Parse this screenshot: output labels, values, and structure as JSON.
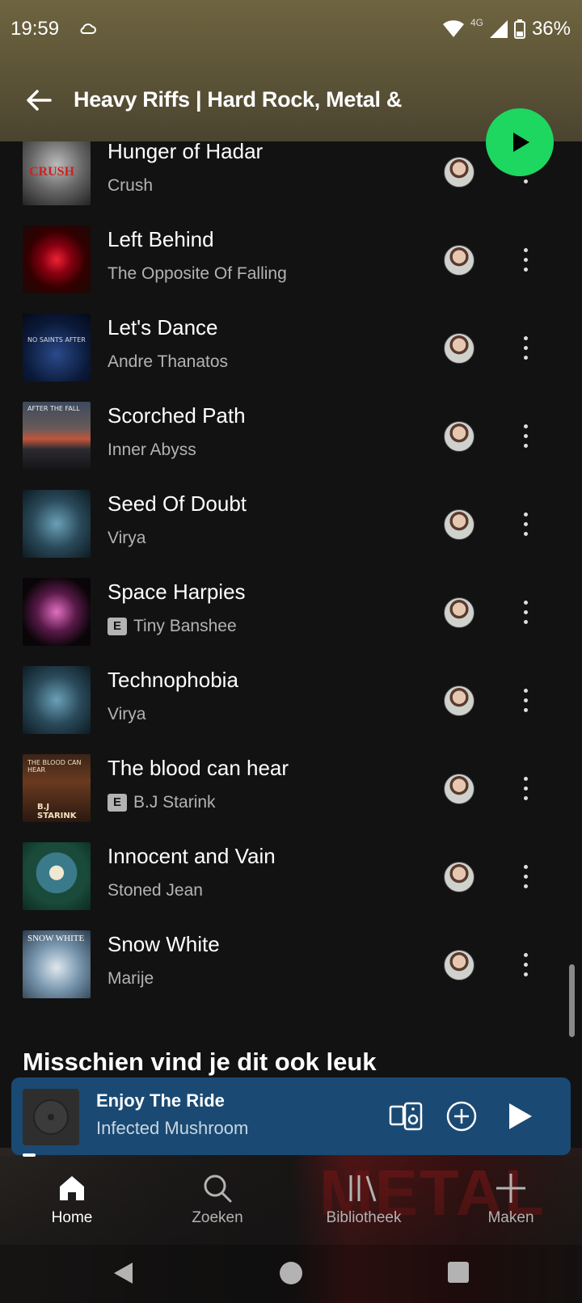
{
  "status_bar": {
    "time": "19:59",
    "network": "4G",
    "battery": "36%"
  },
  "header": {
    "title": "Heavy Riffs | Hard Rock, Metal &"
  },
  "tracks": [
    {
      "title": "Hunger of Hadar",
      "artist": "Crush",
      "explicit": false
    },
    {
      "title": "Left Behind",
      "artist": "The Opposite Of Falling",
      "explicit": false
    },
    {
      "title": "Let's Dance",
      "artist": "Andre Thanatos",
      "explicit": false
    },
    {
      "title": "Scorched Path",
      "artist": "Inner Abyss",
      "explicit": false
    },
    {
      "title": "Seed Of Doubt",
      "artist": "Virya",
      "explicit": false
    },
    {
      "title": "Space Harpies",
      "artist": "Tiny Banshee",
      "explicit": true
    },
    {
      "title": "Technophobia",
      "artist": "Virya",
      "explicit": false
    },
    {
      "title": "The blood can hear",
      "artist": "B.J Starink",
      "explicit": true
    },
    {
      "title": "Innocent and Vain",
      "artist": "Stoned Jean",
      "explicit": false
    },
    {
      "title": "Snow White",
      "artist": "Marije",
      "explicit": false
    }
  ],
  "explicit_label": "E",
  "section": {
    "title": "Misschien vind je dit ook leuk"
  },
  "now_playing": {
    "title": "Enjoy The Ride",
    "artist": "Infected Mushroom"
  },
  "nav": [
    {
      "label": "Home",
      "icon": "home-icon",
      "active": true
    },
    {
      "label": "Zoeken",
      "icon": "search-icon",
      "active": false
    },
    {
      "label": "Bibliotheek",
      "icon": "library-icon",
      "active": false
    },
    {
      "label": "Maken",
      "icon": "plus-icon",
      "active": false
    }
  ],
  "colors": {
    "accent": "#1ed760",
    "miniplayer": "#1a4a73",
    "header": "#5a5236",
    "background": "#121212"
  }
}
